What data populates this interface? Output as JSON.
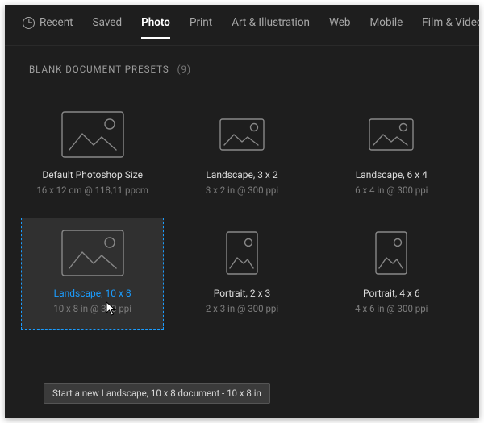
{
  "tabs": {
    "recent": "Recent",
    "saved": "Saved",
    "photo": "Photo",
    "print": "Print",
    "art": "Art & Illustration",
    "web": "Web",
    "mobile": "Mobile",
    "film": "Film & Video"
  },
  "section": {
    "label": "BLANK DOCUMENT PRESETS",
    "count": "(9)"
  },
  "presets": [
    {
      "title": "Default Photoshop Size",
      "meta": "16 x 12 cm @ 118,11 ppcm"
    },
    {
      "title": "Landscape, 3 x 2",
      "meta": "3 x 2 in @ 300 ppi"
    },
    {
      "title": "Landscape, 6 x 4",
      "meta": "6 x 4 in @ 300 ppi"
    },
    {
      "title": "Landscape, 10 x 8",
      "meta": "10 x 8 in @ 300 ppi"
    },
    {
      "title": "Portrait, 2 x 3",
      "meta": "2 x 3 in @ 300 ppi"
    },
    {
      "title": "Portrait, 4 x 6",
      "meta": "4 x 6 in @ 300 ppi"
    }
  ],
  "tooltip": "Start a new Landscape, 10 x 8 document - 10 x 8 in"
}
